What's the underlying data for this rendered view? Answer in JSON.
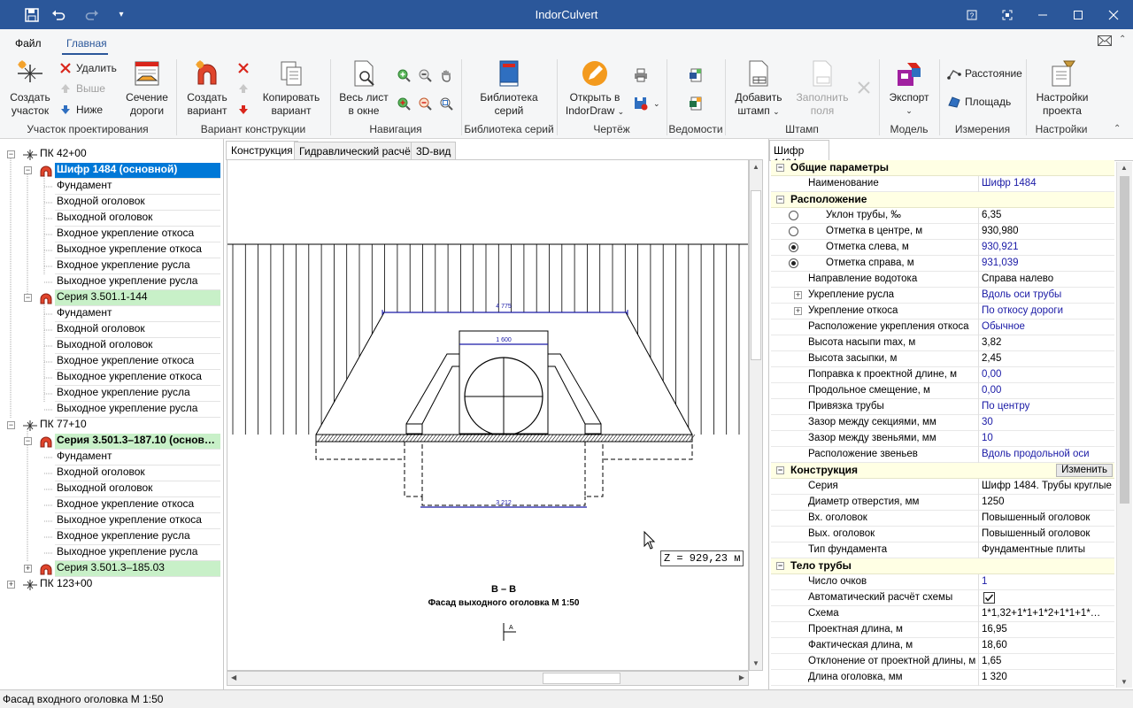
{
  "window": {
    "title": "IndorCulvert",
    "colors": {
      "titlebar": "#2b579a",
      "selected": "#0078d7",
      "series_highlight": "#c8f0c8",
      "category": "#ffffe4",
      "link_value": "#1a1aa6"
    }
  },
  "menu": {
    "file": "Файл",
    "home": "Главная"
  },
  "ribbon": {
    "groups": {
      "section": "Участок проектирования",
      "variant": "Вариант конструкции",
      "navigation": "Навигация",
      "library": "Библиотека серий",
      "drawing": "Чертёж",
      "statements": "Ведомости",
      "stamp": "Штамп",
      "model": "Модель",
      "measure": "Измерения",
      "settings": "Настройки"
    },
    "create_section": [
      "Создать",
      "участок"
    ],
    "delete": "Удалить",
    "up": "Выше",
    "down": "Ниже",
    "road_section": [
      "Сечение",
      "дороги"
    ],
    "create_variant": [
      "Создать",
      "вариант"
    ],
    "copy_variant": [
      "Копировать",
      "вариант"
    ],
    "whole_sheet": [
      "Весь лист",
      "в окне"
    ],
    "series_library": [
      "Библиотека",
      "серий"
    ],
    "open_indordraw": [
      "Открыть в",
      "IndorDraw"
    ],
    "add_stamp": [
      "Добавить",
      "штамп"
    ],
    "fill_fields": [
      "Заполнить",
      "поля"
    ],
    "export": "Экспорт",
    "distance": "Расстояние",
    "area": "Площадь",
    "project_settings": [
      "Настройки",
      "проекта"
    ]
  },
  "tree": [
    {
      "label": "ПК 42+00",
      "level": 0,
      "toggle": "-"
    },
    {
      "label": "Шифр 1484 (основной)",
      "level": 1,
      "toggle": "-",
      "state": "selected"
    },
    {
      "label": "Фундамент",
      "level": 2
    },
    {
      "label": "Входной оголовок",
      "level": 2
    },
    {
      "label": "Выходной оголовок",
      "level": 2
    },
    {
      "label": "Входное укрепление откоса",
      "level": 2
    },
    {
      "label": "Выходное укрепление откоса",
      "level": 2
    },
    {
      "label": "Входное укрепление русла",
      "level": 2
    },
    {
      "label": "Выходное укрепление русла",
      "level": 2
    },
    {
      "label": "Серия 3.501.1-144",
      "level": 1,
      "toggle": "-",
      "state": "series"
    },
    {
      "label": "Фундамент",
      "level": 2
    },
    {
      "label": "Входной оголовок",
      "level": 2
    },
    {
      "label": "Выходной оголовок",
      "level": 2
    },
    {
      "label": "Входное укрепление откоса",
      "level": 2
    },
    {
      "label": "Выходное укрепление откоса",
      "level": 2
    },
    {
      "label": "Входное укрепление русла",
      "level": 2
    },
    {
      "label": "Выходное укрепление русла",
      "level": 2
    },
    {
      "label": "ПК 77+10",
      "level": 0,
      "toggle": "-"
    },
    {
      "label": "Серия 3.501.3–187.10 (основ…",
      "level": 1,
      "toggle": "-",
      "state": "series-bold"
    },
    {
      "label": "Фундамент",
      "level": 2
    },
    {
      "label": "Входной оголовок",
      "level": 2
    },
    {
      "label": "Выходной оголовок",
      "level": 2
    },
    {
      "label": "Входное укрепление откоса",
      "level": 2
    },
    {
      "label": "Выходное укрепление откоса",
      "level": 2
    },
    {
      "label": "Входное укрепление русла",
      "level": 2
    },
    {
      "label": "Выходное укрепление русла",
      "level": 2
    },
    {
      "label": "Серия 3.501.3–185.03",
      "level": 1,
      "toggle": "+",
      "state": "series"
    },
    {
      "label": "ПК 123+00",
      "level": 0,
      "toggle": "+"
    }
  ],
  "center_tabs": [
    "Конструкция",
    "Гидравлический расчёт",
    "3D-вид"
  ],
  "drawing": {
    "dim_top": "4 775",
    "dim_inner": "1 600",
    "dim_bottom": "3 212",
    "caption1": "В – В",
    "caption2": "Фасад выходного оголовка М 1:50",
    "marker": "А",
    "tooltip": "Z = 929,23 м"
  },
  "props": {
    "tab": "Шифр 1484",
    "change_button": "Изменить",
    "rows": [
      {
        "type": "cat",
        "label": "Общие параметры"
      },
      {
        "name": "Наименование",
        "value": "Шифр 1484",
        "blue": true
      },
      {
        "type": "cat",
        "label": "Расположение"
      },
      {
        "name": "Уклон трубы, ‰",
        "value": "6,35",
        "radio": "off"
      },
      {
        "name": "Отметка в центре, м",
        "value": "930,980",
        "radio": "off"
      },
      {
        "name": "Отметка слева, м",
        "value": "930,921",
        "radio": "on",
        "blue": true
      },
      {
        "name": "Отметка справа, м",
        "value": "931,039",
        "radio": "on",
        "blue": true
      },
      {
        "name": "Направление водотока",
        "value": "Справа налево"
      },
      {
        "name": "Укрепление русла",
        "value": "Вдоль оси трубы",
        "blue": true,
        "expand": true
      },
      {
        "name": "Укрепление откоса",
        "value": "По откосу дороги",
        "blue": true,
        "expand": true
      },
      {
        "name": "Расположение укрепления откоса",
        "value": "Обычное",
        "blue": true
      },
      {
        "name": "Высота насыпи max, м",
        "value": "3,82"
      },
      {
        "name": "Высота засыпки, м",
        "value": "2,45"
      },
      {
        "name": "Поправка к проектной длине, м",
        "value": "0,00",
        "blue": true
      },
      {
        "name": "Продольное смещение, м",
        "value": "0,00",
        "blue": true
      },
      {
        "name": "Привязка трубы",
        "value": "По центру",
        "blue": true
      },
      {
        "name": "Зазор между секциями, мм",
        "value": "30",
        "blue": true
      },
      {
        "name": "Зазор между звеньями, мм",
        "value": "10",
        "blue": true
      },
      {
        "name": "Расположение звеньев",
        "value": "Вдоль продольной оси",
        "blue": true
      },
      {
        "type": "cat",
        "label": "Конструкция",
        "button": true
      },
      {
        "name": "Серия",
        "value": "Шифр 1484. Трубы круглые"
      },
      {
        "name": "Диаметр отверстия, мм",
        "value": "1250"
      },
      {
        "name": "Вх. оголовок",
        "value": "Повышенный оголовок"
      },
      {
        "name": "Вых. оголовок",
        "value": "Повышенный оголовок"
      },
      {
        "name": "Тип фундамента",
        "value": "Фундаментные плиты"
      },
      {
        "type": "cat",
        "label": "Тело трубы"
      },
      {
        "name": "Число очков",
        "value": "1",
        "blue": true
      },
      {
        "name": "Автоматический расчёт схемы",
        "value": "",
        "checkbox": true
      },
      {
        "name": "Схема",
        "value": "1*1,32+1*1+1*2+1*1+1*…"
      },
      {
        "name": "Проектная длина, м",
        "value": "16,95"
      },
      {
        "name": "Фактическая длина, м",
        "value": "18,60"
      },
      {
        "name": "Отклонение от проектной длины, м",
        "value": "1,65"
      },
      {
        "name": "Длина оголовка, мм",
        "value": "1 320"
      }
    ]
  },
  "status": "Фасад входного оголовка М 1:50"
}
